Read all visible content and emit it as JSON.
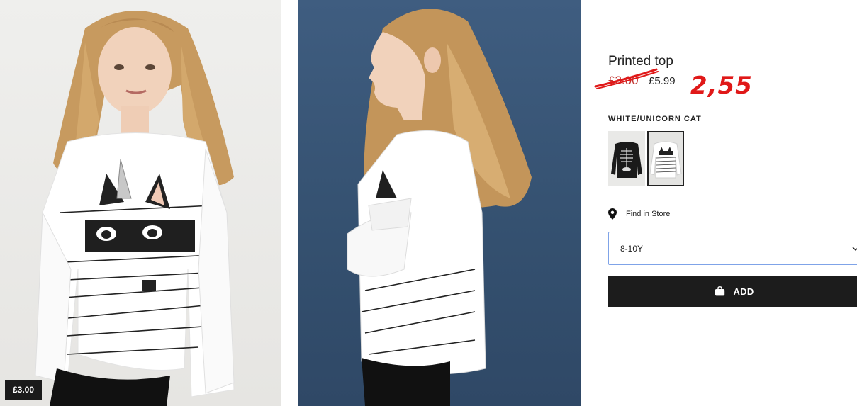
{
  "images": {
    "front": {
      "icon": "model-front-photo"
    },
    "side": {
      "icon": "model-side-photo"
    },
    "price_tag": "£3.00"
  },
  "product": {
    "title": "Printed top",
    "sale_price": "£3.00",
    "original_price": "£5.99",
    "annotation": "2,55",
    "color_name": "WHITE/UNICORN CAT",
    "swatches": [
      {
        "name": "black skeleton",
        "selected": false
      },
      {
        "name": "white unicorn cat",
        "selected": true
      }
    ],
    "find_in_store": "Find in Store",
    "size": {
      "selected": "8-10Y"
    },
    "add_label": "ADD"
  },
  "colors": {
    "sale_red": "#c0322e",
    "annotation_red": "#e01818",
    "button_black": "#1c1c1c",
    "select_border": "#7fa3e8",
    "side_background": "#3f5d80"
  }
}
